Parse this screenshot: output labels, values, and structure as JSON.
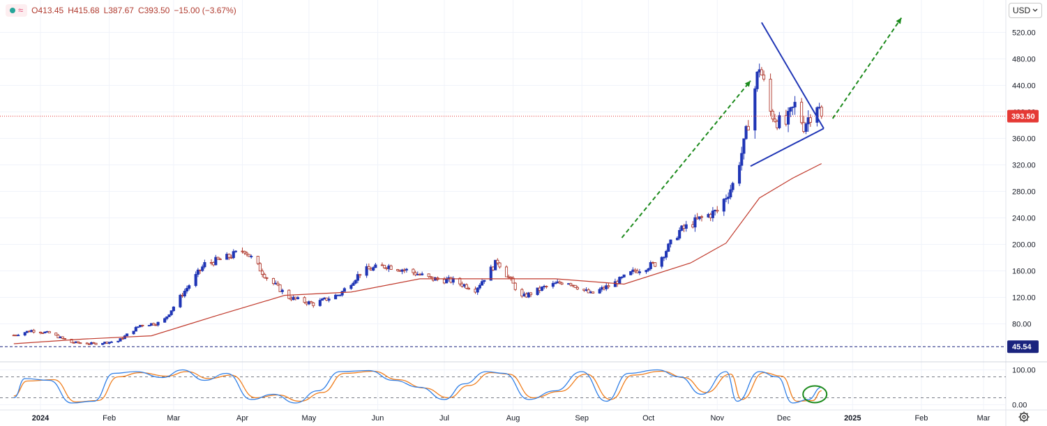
{
  "ohlc": {
    "open": "O413.45",
    "high": "H415.68",
    "low": "L387.67",
    "close": "C393.50",
    "change": "−15.00 (−3.67%)"
  },
  "currency": {
    "label": "USD",
    "icon": "chevron-down-icon"
  },
  "icons": {
    "status": "live-dot-icon",
    "indicator": "wave-icon",
    "settings": "gear-icon"
  },
  "colors": {
    "up_candle": "#1f35b5",
    "down_candle": "#b03a2e",
    "moving_average": "#c0392b",
    "stoch_k": "#2f7ee6",
    "stoch_d": "#ef7c1a",
    "annotation_arrows": "#1b8a1b",
    "triangle": "#1f35b5",
    "support_line": "#1a237e",
    "price_tag": "#e53935"
  },
  "chart_data": [
    {
      "type": "candlestick",
      "y_ticks": [
        80,
        120,
        160,
        200,
        240,
        280,
        320,
        360,
        400,
        440,
        480,
        520
      ],
      "y_tick_labels": [
        "80.00",
        "120.00",
        "160.00",
        "200.00",
        "240.00",
        "280.00",
        "320.00",
        "360.00",
        "400.00",
        "440.00",
        "480.00",
        "520.00"
      ],
      "ylim": [
        30,
        548
      ],
      "x_tick_labels": [
        "2024",
        "Feb",
        "Mar",
        "Apr",
        "May",
        "Jun",
        "Jul",
        "Aug",
        "Sep",
        "Oct",
        "Nov",
        "Dec",
        "2025",
        "Feb",
        "Mar"
      ],
      "x_tick_dates": [
        "2024-01-01",
        "2024-02-01",
        "2024-03-01",
        "2024-04-01",
        "2024-05-01",
        "2024-06-01",
        "2024-07-01",
        "2024-08-01",
        "2024-09-01",
        "2024-10-01",
        "2024-11-01",
        "2024-12-01",
        "2025-01-01",
        "2025-02-01",
        "2025-03-01"
      ],
      "last_price": {
        "value": 393.5,
        "label": "393.50"
      },
      "support_level": {
        "value": 45.54,
        "label": "45.54"
      },
      "close_series": [
        {
          "date": "2023-12-20",
          "close": 63
        },
        {
          "date": "2023-12-28",
          "close": 70
        },
        {
          "date": "2024-01-05",
          "close": 66
        },
        {
          "date": "2024-01-15",
          "close": 52
        },
        {
          "date": "2024-01-25",
          "close": 50
        },
        {
          "date": "2024-02-05",
          "close": 54
        },
        {
          "date": "2024-02-15",
          "close": 78
        },
        {
          "date": "2024-02-25",
          "close": 82
        },
        {
          "date": "2024-03-05",
          "close": 125
        },
        {
          "date": "2024-03-15",
          "close": 170
        },
        {
          "date": "2024-03-25",
          "close": 180
        },
        {
          "date": "2024-04-02",
          "close": 192
        },
        {
          "date": "2024-04-12",
          "close": 150
        },
        {
          "date": "2024-04-22",
          "close": 120
        },
        {
          "date": "2024-05-03",
          "close": 110
        },
        {
          "date": "2024-05-15",
          "close": 125
        },
        {
          "date": "2024-05-25",
          "close": 160
        },
        {
          "date": "2024-06-05",
          "close": 168
        },
        {
          "date": "2024-06-15",
          "close": 160
        },
        {
          "date": "2024-06-25",
          "close": 148
        },
        {
          "date": "2024-07-05",
          "close": 145
        },
        {
          "date": "2024-07-15",
          "close": 132
        },
        {
          "date": "2024-07-25",
          "close": 175
        },
        {
          "date": "2024-08-05",
          "close": 120
        },
        {
          "date": "2024-08-15",
          "close": 135
        },
        {
          "date": "2024-08-25",
          "close": 145
        },
        {
          "date": "2024-09-05",
          "close": 125
        },
        {
          "date": "2024-09-15",
          "close": 140
        },
        {
          "date": "2024-09-25",
          "close": 160
        },
        {
          "date": "2024-10-05",
          "close": 172
        },
        {
          "date": "2024-10-15",
          "close": 220
        },
        {
          "date": "2024-10-25",
          "close": 240
        },
        {
          "date": "2024-11-01",
          "close": 250
        },
        {
          "date": "2024-11-08",
          "close": 290
        },
        {
          "date": "2024-11-13",
          "close": 350
        },
        {
          "date": "2024-11-20",
          "close": 470
        },
        {
          "date": "2024-11-25",
          "close": 400
        },
        {
          "date": "2024-12-01",
          "close": 375
        },
        {
          "date": "2024-12-06",
          "close": 410
        },
        {
          "date": "2024-12-10",
          "close": 380
        },
        {
          "date": "2024-12-16",
          "close": 413
        },
        {
          "date": "2024-12-18",
          "close": 393.5
        }
      ],
      "moving_average_series": [
        {
          "date": "2023-12-20",
          "value": 50
        },
        {
          "date": "2024-01-20",
          "value": 57
        },
        {
          "date": "2024-02-20",
          "value": 62
        },
        {
          "date": "2024-03-20",
          "value": 92
        },
        {
          "date": "2024-04-20",
          "value": 123
        },
        {
          "date": "2024-05-20",
          "value": 128
        },
        {
          "date": "2024-06-20",
          "value": 148
        },
        {
          "date": "2024-07-20",
          "value": 148
        },
        {
          "date": "2024-08-20",
          "value": 148
        },
        {
          "date": "2024-09-20",
          "value": 140
        },
        {
          "date": "2024-10-20",
          "value": 172
        },
        {
          "date": "2024-11-05",
          "value": 202
        },
        {
          "date": "2024-11-20",
          "value": 270
        },
        {
          "date": "2024-12-05",
          "value": 300
        },
        {
          "date": "2024-12-18",
          "value": 322
        }
      ],
      "annotations": {
        "triangle_upper": [
          {
            "date": "2024-11-21",
            "value": 535
          },
          {
            "date": "2024-12-19",
            "value": 375
          }
        ],
        "triangle_lower": [
          {
            "date": "2024-11-16",
            "value": 318
          },
          {
            "date": "2024-12-19",
            "value": 375
          }
        ],
        "arrow_1": [
          {
            "date": "2024-09-19",
            "value": 210
          },
          {
            "date": "2024-11-16",
            "value": 447
          }
        ],
        "arrow_2": [
          {
            "date": "2024-12-23",
            "value": 390
          },
          {
            "date": "2025-01-23",
            "value": 542
          }
        ]
      }
    },
    {
      "type": "line",
      "panel": "stochastic oscillator",
      "y_ticks": [
        0,
        100
      ],
      "y_tick_labels": [
        "0.00",
        "100.00"
      ],
      "ylim": [
        -6,
        110
      ],
      "bands": [
        20,
        80
      ],
      "k_series": [
        {
          "date": "2023-12-20",
          "value": 20
        },
        {
          "date": "2023-12-25",
          "value": 75
        },
        {
          "date": "2024-01-05",
          "value": 70
        },
        {
          "date": "2024-01-15",
          "value": 5
        },
        {
          "date": "2024-01-25",
          "value": 10
        },
        {
          "date": "2024-02-03",
          "value": 90
        },
        {
          "date": "2024-02-13",
          "value": 95
        },
        {
          "date": "2024-02-25",
          "value": 78
        },
        {
          "date": "2024-03-05",
          "value": 100
        },
        {
          "date": "2024-03-15",
          "value": 70
        },
        {
          "date": "2024-03-25",
          "value": 90
        },
        {
          "date": "2024-04-05",
          "value": 15
        },
        {
          "date": "2024-04-15",
          "value": 30
        },
        {
          "date": "2024-04-25",
          "value": 5
        },
        {
          "date": "2024-05-05",
          "value": 40
        },
        {
          "date": "2024-05-15",
          "value": 95
        },
        {
          "date": "2024-05-28",
          "value": 98
        },
        {
          "date": "2024-06-08",
          "value": 70
        },
        {
          "date": "2024-06-20",
          "value": 50
        },
        {
          "date": "2024-07-01",
          "value": 15
        },
        {
          "date": "2024-07-10",
          "value": 60
        },
        {
          "date": "2024-07-20",
          "value": 95
        },
        {
          "date": "2024-07-28",
          "value": 90
        },
        {
          "date": "2024-08-08",
          "value": 15
        },
        {
          "date": "2024-08-20",
          "value": 40
        },
        {
          "date": "2024-09-01",
          "value": 95
        },
        {
          "date": "2024-09-12",
          "value": 10
        },
        {
          "date": "2024-09-22",
          "value": 90
        },
        {
          "date": "2024-10-05",
          "value": 100
        },
        {
          "date": "2024-10-15",
          "value": 80
        },
        {
          "date": "2024-10-25",
          "value": 30
        },
        {
          "date": "2024-11-05",
          "value": 95
        },
        {
          "date": "2024-11-10",
          "value": 10
        },
        {
          "date": "2024-11-20",
          "value": 95
        },
        {
          "date": "2024-11-28",
          "value": 80
        },
        {
          "date": "2024-12-05",
          "value": 5
        },
        {
          "date": "2024-12-12",
          "value": 15
        },
        {
          "date": "2024-12-18",
          "value": 50
        }
      ],
      "d_series": [
        {
          "date": "2023-12-20",
          "value": 25
        },
        {
          "date": "2023-12-26",
          "value": 68
        },
        {
          "date": "2024-01-07",
          "value": 72
        },
        {
          "date": "2024-01-17",
          "value": 8
        },
        {
          "date": "2024-01-27",
          "value": 12
        },
        {
          "date": "2024-02-05",
          "value": 80
        },
        {
          "date": "2024-02-15",
          "value": 92
        },
        {
          "date": "2024-02-27",
          "value": 82
        },
        {
          "date": "2024-03-07",
          "value": 95
        },
        {
          "date": "2024-03-17",
          "value": 75
        },
        {
          "date": "2024-03-27",
          "value": 85
        },
        {
          "date": "2024-04-07",
          "value": 20
        },
        {
          "date": "2024-04-17",
          "value": 28
        },
        {
          "date": "2024-04-27",
          "value": 10
        },
        {
          "date": "2024-05-07",
          "value": 35
        },
        {
          "date": "2024-05-17",
          "value": 90
        },
        {
          "date": "2024-05-30",
          "value": 96
        },
        {
          "date": "2024-06-10",
          "value": 72
        },
        {
          "date": "2024-06-22",
          "value": 48
        },
        {
          "date": "2024-07-03",
          "value": 20
        },
        {
          "date": "2024-07-12",
          "value": 55
        },
        {
          "date": "2024-07-22",
          "value": 92
        },
        {
          "date": "2024-07-30",
          "value": 88
        },
        {
          "date": "2024-08-10",
          "value": 20
        },
        {
          "date": "2024-08-22",
          "value": 38
        },
        {
          "date": "2024-09-03",
          "value": 88
        },
        {
          "date": "2024-09-14",
          "value": 15
        },
        {
          "date": "2024-09-24",
          "value": 85
        },
        {
          "date": "2024-10-07",
          "value": 96
        },
        {
          "date": "2024-10-17",
          "value": 78
        },
        {
          "date": "2024-10-27",
          "value": 35
        },
        {
          "date": "2024-11-07",
          "value": 88
        },
        {
          "date": "2024-11-12",
          "value": 15
        },
        {
          "date": "2024-11-22",
          "value": 92
        },
        {
          "date": "2024-11-30",
          "value": 82
        },
        {
          "date": "2024-12-07",
          "value": 10
        },
        {
          "date": "2024-12-14",
          "value": 12
        },
        {
          "date": "2024-12-18",
          "value": 40
        }
      ],
      "highlight": {
        "date": "2024-12-15",
        "value": 30
      }
    }
  ]
}
